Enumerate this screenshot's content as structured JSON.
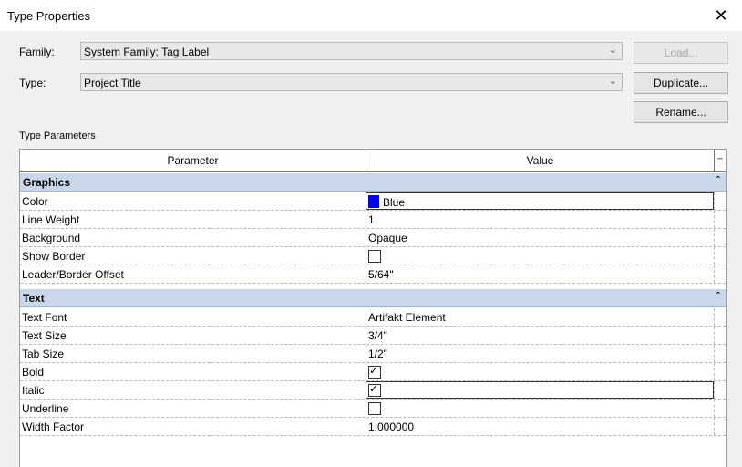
{
  "window": {
    "title": "Type Properties",
    "close_glyph": "✕"
  },
  "family": {
    "label": "Family:",
    "value": "System Family: Tag Label"
  },
  "type": {
    "label": "Type:",
    "value": "Project Title"
  },
  "buttons": {
    "load": "Load...",
    "duplicate": "Duplicate...",
    "rename": "Rename..."
  },
  "type_parameters": {
    "label": "Type Parameters",
    "headers": {
      "parameter": "Parameter",
      "value": "Value",
      "sort": "="
    },
    "groups": [
      {
        "name": "Graphics",
        "rows": [
          {
            "parameter": "Color",
            "value": "Blue",
            "kind": "color",
            "swatch": "#0000ff"
          },
          {
            "parameter": "Line Weight",
            "value": "1",
            "kind": "text"
          },
          {
            "parameter": "Background",
            "value": "Opaque",
            "kind": "text"
          },
          {
            "parameter": "Show Border",
            "checked": false,
            "kind": "check"
          },
          {
            "parameter": "Leader/Border Offset",
            "value": "5/64\"",
            "kind": "text"
          }
        ]
      },
      {
        "name": "Text",
        "rows": [
          {
            "parameter": "Text Font",
            "value": "Artifakt Element",
            "kind": "text"
          },
          {
            "parameter": "Text Size",
            "value": "3/4\"",
            "kind": "text"
          },
          {
            "parameter": "Tab Size",
            "value": "1/2\"",
            "kind": "text"
          },
          {
            "parameter": "Bold",
            "checked": true,
            "kind": "check"
          },
          {
            "parameter": "Italic",
            "checked": true,
            "kind": "check"
          },
          {
            "parameter": "Underline",
            "checked": false,
            "kind": "check"
          },
          {
            "parameter": "Width Factor",
            "value": "1.000000",
            "kind": "text"
          }
        ]
      }
    ]
  }
}
